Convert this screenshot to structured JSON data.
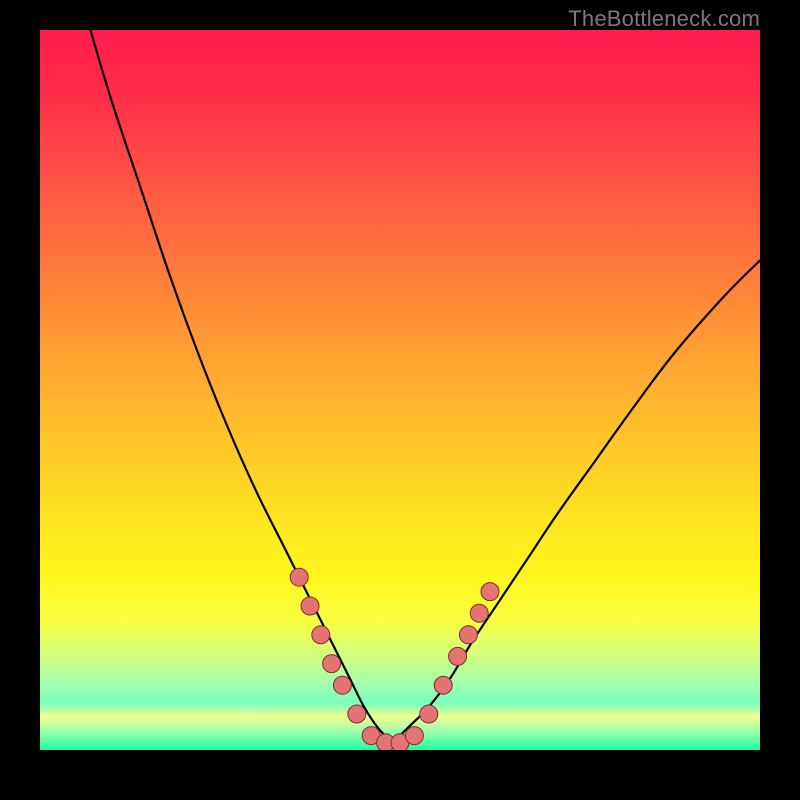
{
  "attribution": "TheBottleneck.com",
  "colors": {
    "frame_bg": "#000000",
    "curve": "#000000",
    "dot_fill": "#e57373",
    "dot_stroke": "#7a2f2f",
    "gradient_top": "#ff1e4e",
    "gradient_bottom": "#1effa0"
  },
  "chart_data": {
    "type": "line",
    "title": "",
    "xlabel": "",
    "ylabel": "",
    "xlim": [
      0,
      100
    ],
    "ylim": [
      0,
      100
    ],
    "grid": false,
    "series": [
      {
        "name": "left-curve",
        "x": [
          7,
          10,
          14,
          18,
          22,
          26,
          30,
          34,
          37,
          39,
          41,
          43,
          45,
          47,
          49
        ],
        "y": [
          100,
          90,
          78,
          66,
          55,
          45,
          36,
          28,
          22,
          18,
          14,
          10,
          6,
          3,
          1
        ]
      },
      {
        "name": "right-curve",
        "x": [
          49,
          51,
          54,
          57,
          60,
          64,
          68,
          72,
          77,
          82,
          88,
          95,
          100
        ],
        "y": [
          1,
          3,
          6,
          10,
          15,
          21,
          27,
          33,
          40,
          47,
          55,
          63,
          68
        ]
      }
    ],
    "dots": {
      "name": "markers",
      "x": [
        36,
        37.5,
        39,
        40.5,
        42,
        44,
        46,
        48,
        50,
        52,
        54,
        56,
        58,
        59.5,
        61,
        62.5
      ],
      "y": [
        24,
        20,
        16,
        12,
        9,
        5,
        2,
        1,
        1,
        2,
        5,
        9,
        13,
        16,
        19,
        22
      ]
    }
  }
}
